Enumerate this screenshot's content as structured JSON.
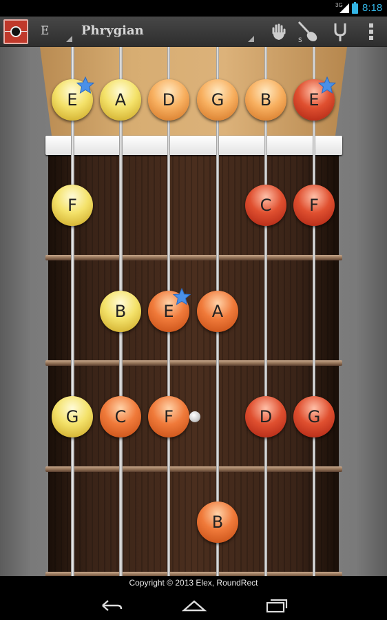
{
  "status_bar": {
    "network": "3G",
    "time": "8:18",
    "accent": "#33b5e5"
  },
  "action_bar": {
    "key": "E",
    "scale": "Phrygian",
    "icons": [
      "app-icon",
      "hand-icon",
      "guitar-icon",
      "tuning-fork-icon",
      "overflow-menu-icon"
    ]
  },
  "fretboard": {
    "strings": 6,
    "frets_visible": 4,
    "notes": [
      {
        "string": 1,
        "fret": 0,
        "name": "E",
        "color": "yellow",
        "root": true
      },
      {
        "string": 2,
        "fret": 0,
        "name": "A",
        "color": "yellow",
        "root": false
      },
      {
        "string": 3,
        "fret": 0,
        "name": "D",
        "color": "peach",
        "root": false
      },
      {
        "string": 4,
        "fret": 0,
        "name": "G",
        "color": "peach",
        "root": false
      },
      {
        "string": 5,
        "fret": 0,
        "name": "B",
        "color": "peach",
        "root": false
      },
      {
        "string": 6,
        "fret": 0,
        "name": "E",
        "color": "red",
        "root": true
      },
      {
        "string": 1,
        "fret": 1,
        "name": "F",
        "color": "yellow",
        "root": false
      },
      {
        "string": 5,
        "fret": 1,
        "name": "C",
        "color": "red",
        "root": false
      },
      {
        "string": 6,
        "fret": 1,
        "name": "F",
        "color": "red",
        "root": false
      },
      {
        "string": 2,
        "fret": 2,
        "name": "B",
        "color": "yellow",
        "root": false
      },
      {
        "string": 3,
        "fret": 2,
        "name": "E",
        "color": "orange",
        "root": true
      },
      {
        "string": 4,
        "fret": 2,
        "name": "A",
        "color": "orange",
        "root": false
      },
      {
        "string": 1,
        "fret": 3,
        "name": "G",
        "color": "yellow",
        "root": false
      },
      {
        "string": 2,
        "fret": 3,
        "name": "C",
        "color": "orange",
        "root": false
      },
      {
        "string": 3,
        "fret": 3,
        "name": "F",
        "color": "orange",
        "root": false
      },
      {
        "string": 5,
        "fret": 3,
        "name": "D",
        "color": "red",
        "root": false
      },
      {
        "string": 6,
        "fret": 3,
        "name": "G",
        "color": "red",
        "root": false
      },
      {
        "string": 4,
        "fret": 4,
        "name": "B",
        "color": "orange",
        "root": false
      }
    ]
  },
  "footer": {
    "copyright": "Copyright © 2013 Elex, RoundRect"
  },
  "nav_bar": {
    "buttons": [
      "back-icon",
      "home-icon",
      "recent-apps-icon"
    ]
  }
}
